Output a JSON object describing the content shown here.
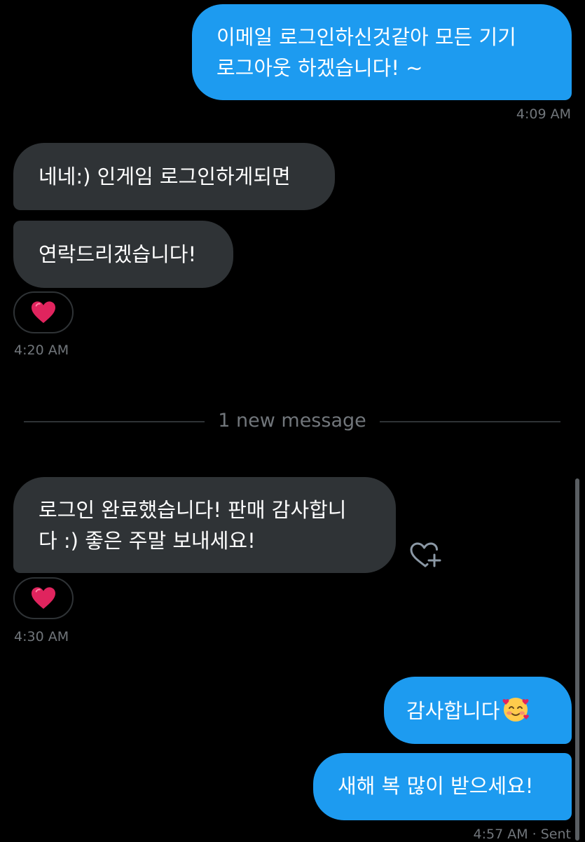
{
  "messages": {
    "m1": {
      "line1": "이메일 로그인하신것같아 모든 기기",
      "line2": "로그아웃 하겠습니다! ~",
      "time": "4:09 AM"
    },
    "m2": {
      "text": "네네:) 인게임 로그인하게되면"
    },
    "m3": {
      "text": "연락드리겠습니다!",
      "reaction": "heart-emoji",
      "time": "4:20 AM"
    },
    "divider": {
      "label": "1 new message"
    },
    "m4": {
      "line1": "로그인 완료했습니다! 판매 감사합니",
      "line2": "다 :) 좋은 주말 보내세요!",
      "reaction": "heart-emoji",
      "time": "4:30 AM"
    },
    "m5": {
      "text": "감사합니다",
      "emoji": "smiling-face-with-hearts-emoji"
    },
    "m6": {
      "text": "새해 복 많이 받으세요!",
      "time": "4:57 AM · Sent"
    }
  },
  "colors": {
    "background": "#000000",
    "sent_bubble": "#1d9bf0",
    "received_bubble": "#2f3336",
    "muted_text": "#71767b",
    "heart": "#e0245e"
  },
  "icons": {
    "add_reaction": "heart-plus-icon",
    "reaction": "red-heart-emoji"
  }
}
